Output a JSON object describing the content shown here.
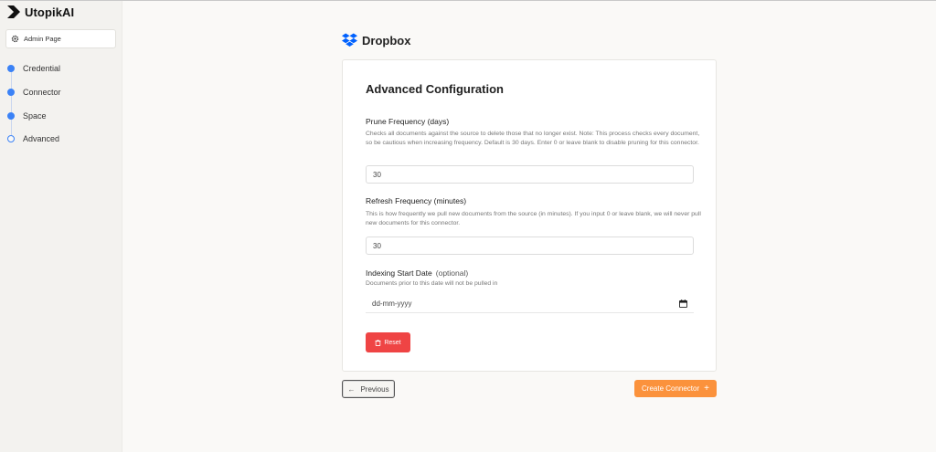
{
  "app": {
    "brand_name": "UtopikAI",
    "admin_button_label": "Admin Page"
  },
  "steps": [
    {
      "label": "Credential",
      "state": "complete"
    },
    {
      "label": "Connector",
      "state": "complete"
    },
    {
      "label": "Space",
      "state": "complete"
    },
    {
      "label": "Advanced",
      "state": "current"
    }
  ],
  "connector": {
    "name": "Dropbox"
  },
  "form": {
    "title": "Advanced Configuration",
    "prune": {
      "label": "Prune Frequency (days)",
      "description": "Checks all documents against the source to delete those that no longer exist. Note: This process checks every document, so be cautious when increasing frequency. Default is 30 days. Enter 0 or leave blank to disable pruning for this connector.",
      "value": "30"
    },
    "refresh": {
      "label": "Refresh Frequency (minutes)",
      "description": "This is how frequently we pull new documents from the source (in minutes). If you input 0 or leave blank, we will never pull new documents for this connector.",
      "value": "30"
    },
    "indexing": {
      "label": "Indexing Start Date",
      "optional_label": "(optional)",
      "description": "Documents prior to this date will not be pulled in",
      "placeholder": "dd-mm-yyyy"
    },
    "reset_label": "Reset"
  },
  "footer": {
    "previous_label": "Previous",
    "previous_icon": "←",
    "create_label": "Create Connector",
    "create_icon": "+"
  },
  "colors": {
    "accent_blue": "#3b82f6",
    "reset_red": "#ef4444",
    "create_orange": "#fb923c",
    "dropbox_blue": "#0061fe"
  }
}
